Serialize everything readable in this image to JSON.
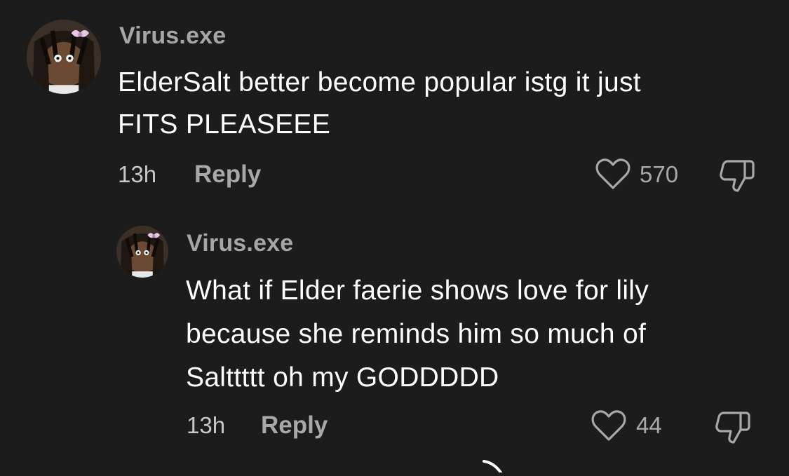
{
  "comments": [
    {
      "username": "Virus.exe",
      "text_lines": [
        "ElderSalt better become popular istg it just",
        "FITS PLEASEEE"
      ],
      "time": "13h",
      "reply_label": "Reply",
      "likes": "570",
      "avatar_icon": "avatar-image",
      "like_icon": "heart-outline-icon",
      "dislike_icon": "thumbs-down-outline-icon"
    },
    {
      "username": "Virus.exe",
      "text_lines": [
        "What if Elder faerie shows love for lily",
        "because she reminds him so much of",
        "Salttttt oh my GODDDDD"
      ],
      "time": "13h",
      "reply_label": "Reply",
      "likes": "44",
      "avatar_icon": "avatar-image",
      "like_icon": "heart-outline-icon",
      "dislike_icon": "thumbs-down-outline-icon"
    }
  ],
  "colors": {
    "background": "#1c1c1c",
    "username": "#a6a6a6",
    "text": "#ffffff",
    "meta": "#a8a8a8"
  }
}
